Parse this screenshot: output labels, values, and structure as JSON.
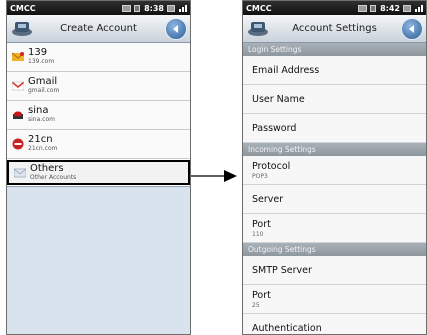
{
  "status_left": {
    "carrier": "CMCC",
    "time": "8:38"
  },
  "status_right": {
    "carrier": "CMCC",
    "time": "8:42"
  },
  "left_screen": {
    "title": "Create Account",
    "accounts": [
      {
        "name": "139",
        "domain": "139.com",
        "icon": "envelope-139-icon",
        "color": "#e8a21a"
      },
      {
        "name": "Gmail",
        "domain": "gmail.com",
        "icon": "gmail-icon",
        "color": "#d23a2e"
      },
      {
        "name": "sina",
        "domain": "sina.com",
        "icon": "sina-icon",
        "color": "#c8161d"
      },
      {
        "name": "21cn",
        "domain": "21cn.com",
        "icon": "21cn-icon",
        "color": "#cc1f1f"
      },
      {
        "name": "Others",
        "domain": "Other Accounts",
        "icon": "envelope-icon",
        "color": "#8aa0b6"
      }
    ]
  },
  "right_screen": {
    "title": "Account Settings",
    "sections": [
      {
        "header": "Login Settings",
        "items": [
          {
            "name": "Email Address",
            "value": ""
          },
          {
            "name": "User Name",
            "value": ""
          },
          {
            "name": "Password",
            "value": ""
          }
        ]
      },
      {
        "header": "Incoming Settings",
        "items": [
          {
            "name": "Protocol",
            "value": "POP3"
          },
          {
            "name": "Server",
            "value": ""
          },
          {
            "name": "Port",
            "value": "110"
          }
        ]
      },
      {
        "header": "Outgoing Settings",
        "items": [
          {
            "name": "SMTP Server",
            "value": ""
          },
          {
            "name": "Port",
            "value": "25"
          },
          {
            "name": "Authentication",
            "value": ""
          }
        ]
      }
    ]
  },
  "colors": {
    "accent": "#2a5d98",
    "section": "#9aa2aa",
    "panel": "#d7e2ee"
  }
}
